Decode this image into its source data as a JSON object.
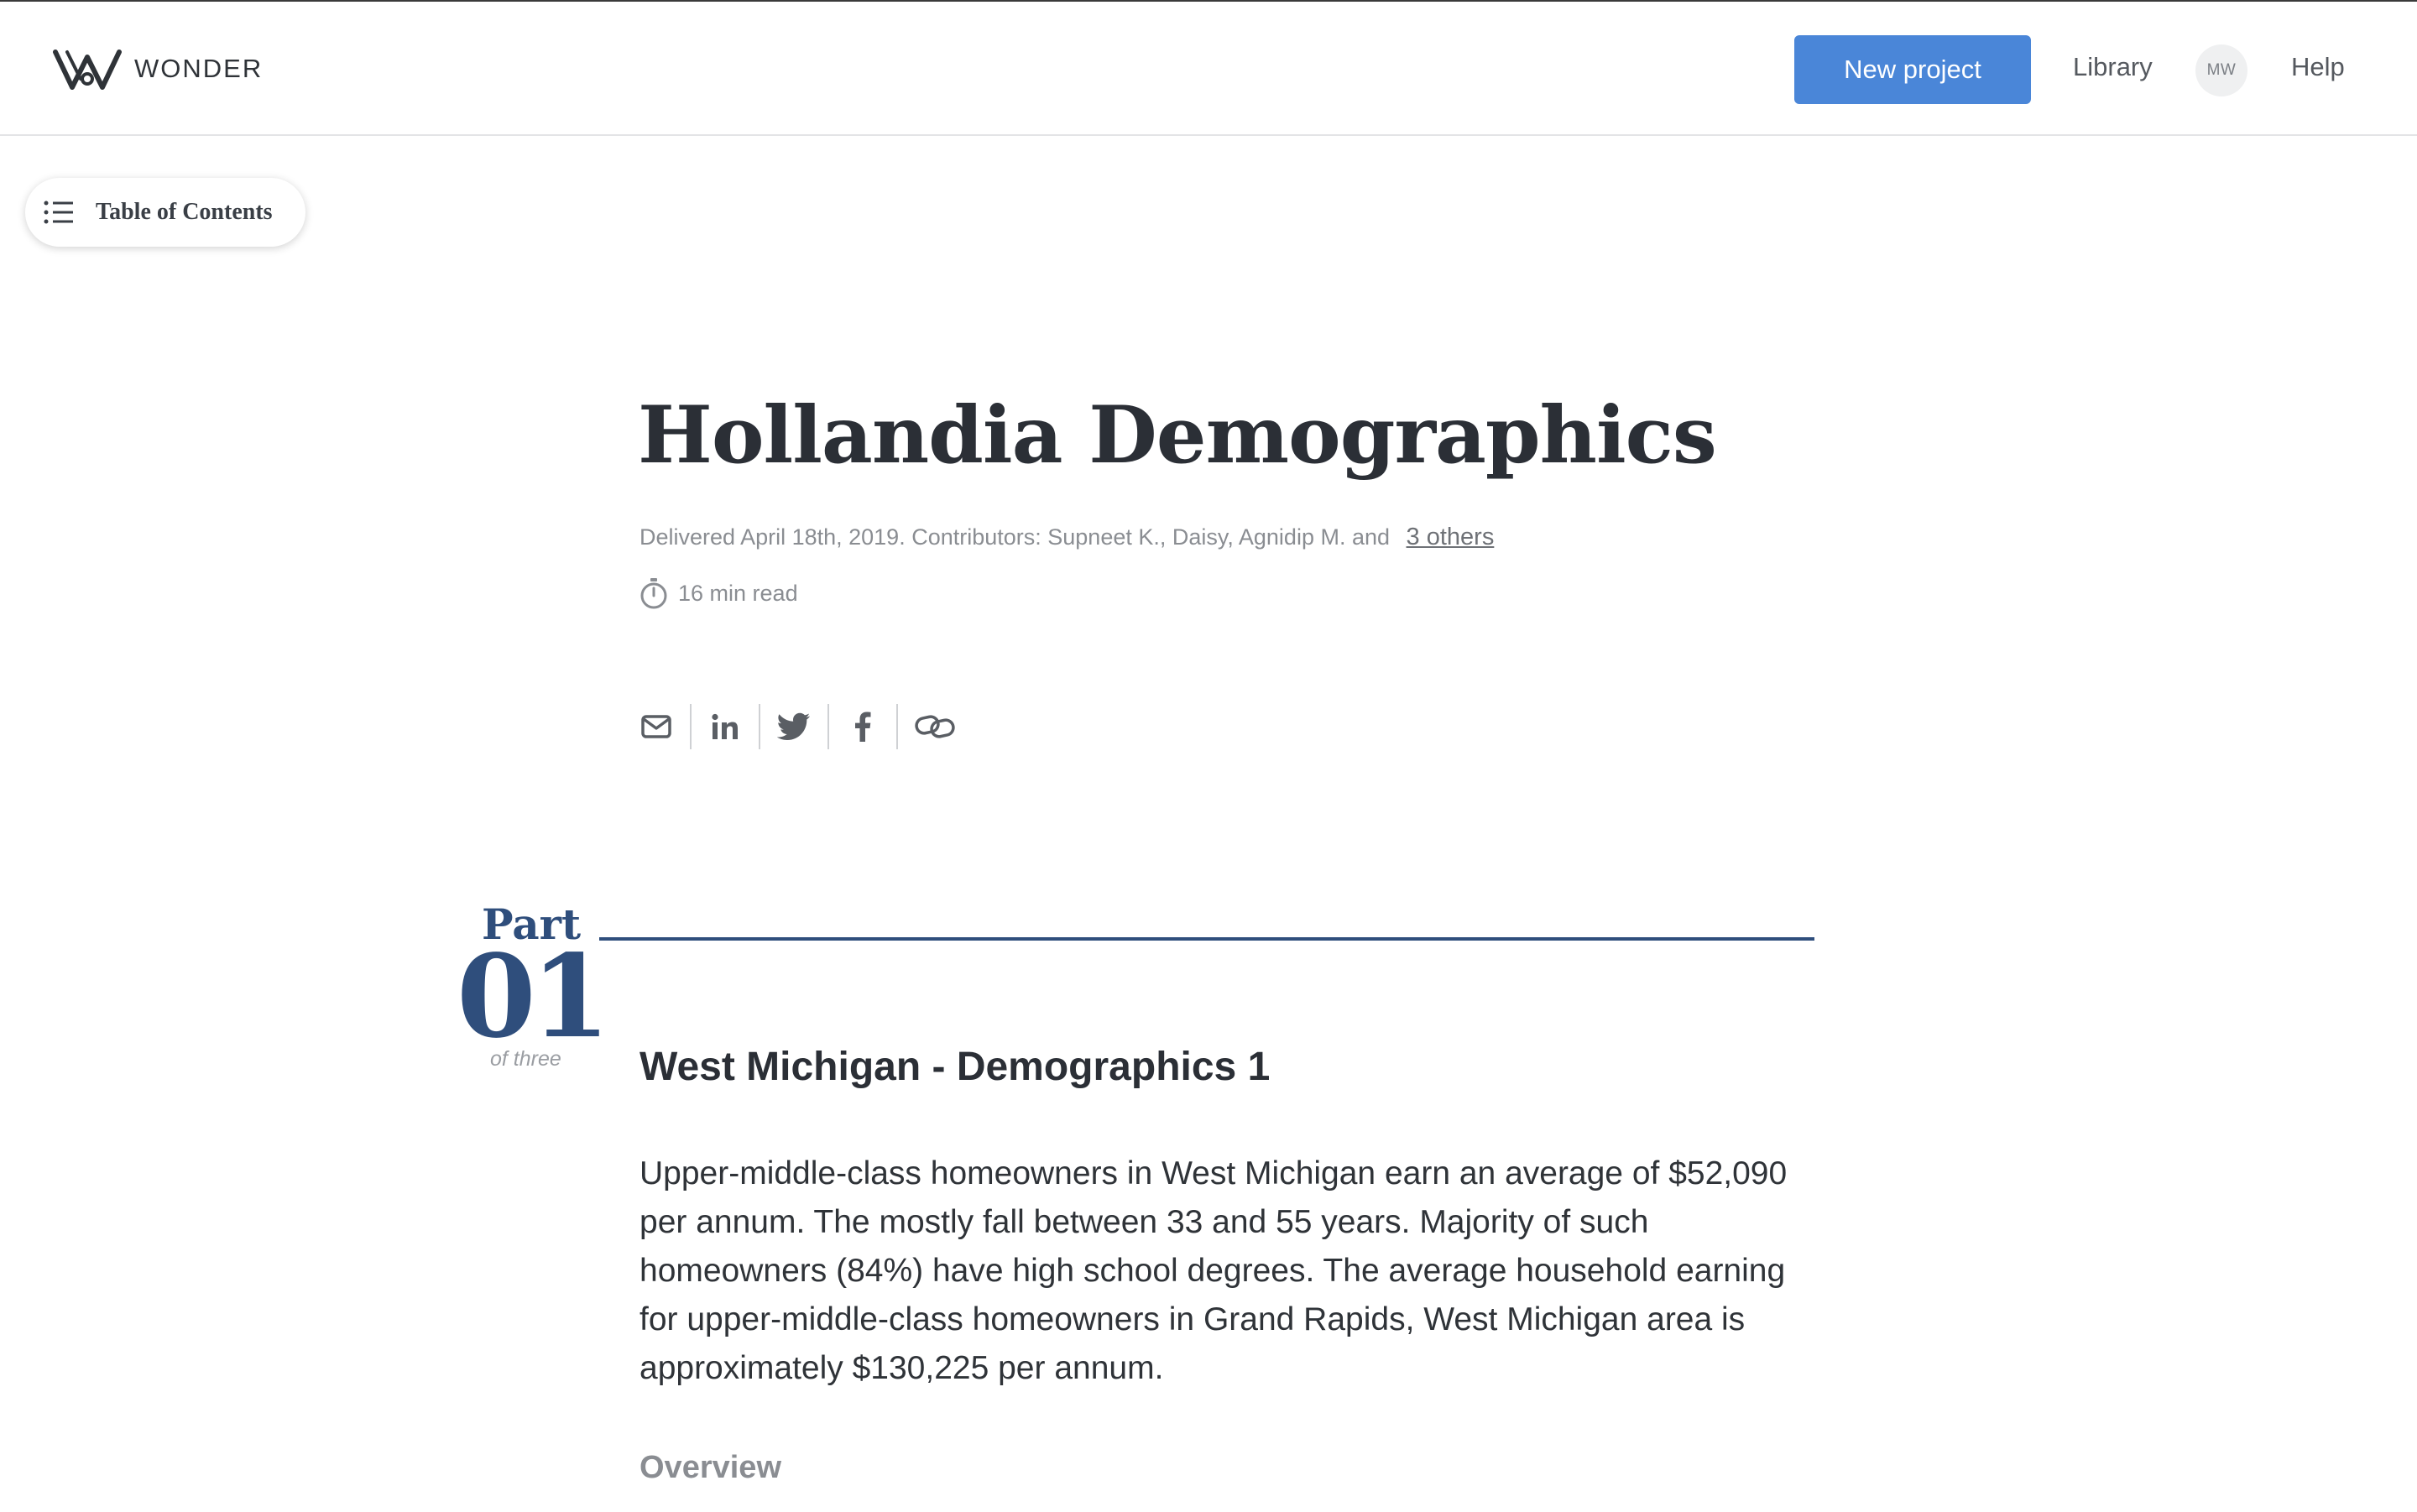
{
  "header": {
    "logo_text": "WONDER",
    "new_project_label": "New project",
    "library_label": "Library",
    "avatar_initials": "MW",
    "help_label": "Help",
    "accent_color": "#4a86d8"
  },
  "toc": {
    "label": "Table of Contents",
    "icon": "list-icon"
  },
  "document": {
    "title": "Hollandia Demographics",
    "meta_text": "Delivered April 18th, 2019. Contributors: Supneet K., Daisy, Agnidip M. and",
    "others_link": "3 others",
    "read_time": "16 min read"
  },
  "share": {
    "icons": [
      "email-icon",
      "linkedin-icon",
      "twitter-icon",
      "facebook-icon",
      "link-icon"
    ]
  },
  "part": {
    "label": "Part",
    "number": "01",
    "of_text": "of three",
    "color": "#2f4e7c",
    "heading": "West Michigan - Demographics 1",
    "body": "Upper-middle-class homeowners in West Michigan earn an average of $52,090 per annum. The mostly fall between 33 and 55 years. Majority of such homeowners (84%) have high school degrees. The average household earning for upper-middle-class homeowners in Grand Rapids, West Michigan area is approximately $130,225 per annum.",
    "subheading": "Overview"
  }
}
